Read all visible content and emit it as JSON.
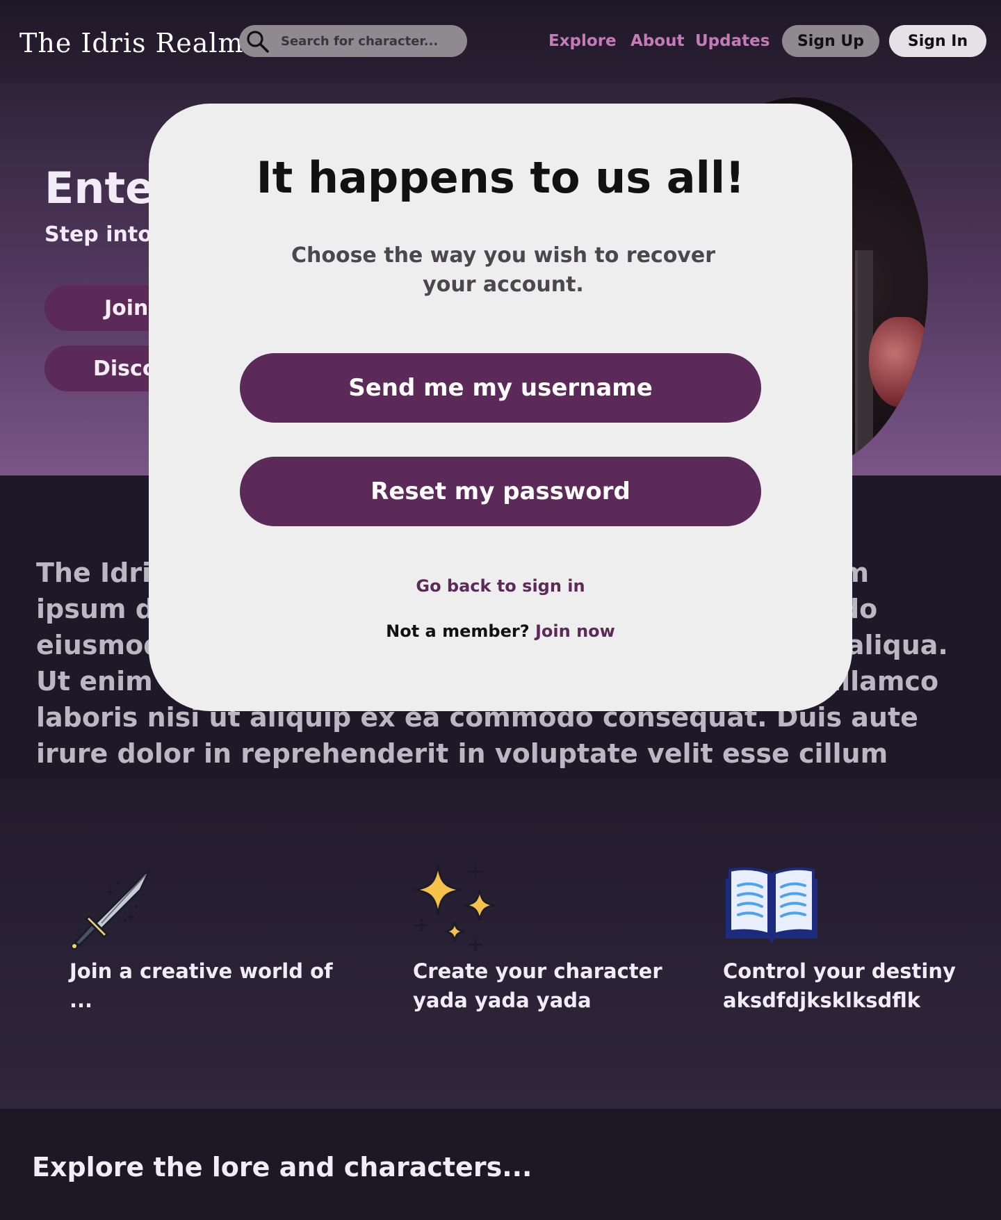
{
  "header": {
    "logo": "The Idris Realm",
    "search_placeholder": "Search for character...",
    "nav": {
      "explore": "Explore",
      "about": "About",
      "updates": "Updates"
    },
    "sign_up": "Sign Up",
    "sign_in": "Sign In"
  },
  "hero": {
    "title": "Enter",
    "subtitle": "Step into a",
    "join_button": "Join",
    "discover_button": "Disco"
  },
  "main": {
    "paragraph": "The Idris Realm is a world built by its community Lorem ipsum dolor sit amet, consectetur adipiscing elit, sed do eiusmod tempor incididunt ut labore et dolore magna aliqua. Ut enim ad minim veniam, quis nostrud exercitation ullamco laboris nisi ut aliquip ex ea commodo consequat. Duis aute irure dolor in reprehenderit in voluptate velit esse cillum dolore eu fugiat nulla pariatur."
  },
  "features": [
    {
      "text": "Join a creative world of ...",
      "icon": "sword-icon"
    },
    {
      "text": "Create your character yada yada yada",
      "icon": "sparkles-icon"
    },
    {
      "text": "Control your destiny aksdfdjksklksdflk",
      "icon": "open-book-icon"
    }
  ],
  "explore": {
    "heading": "Explore the lore and characters..."
  },
  "modal": {
    "title": "It happens to us all!",
    "description": "Choose the way you wish to recover your account.",
    "send_username": "Send me my username",
    "reset_password": "Reset my password",
    "back_link": "Go back to sign in",
    "not_member": "Not a member?",
    "join_now": "Join now"
  },
  "colors": {
    "brand_purple": "#5c2a58",
    "nav_pink": "#c67ab8",
    "modal_bg": "#eeeeee"
  }
}
